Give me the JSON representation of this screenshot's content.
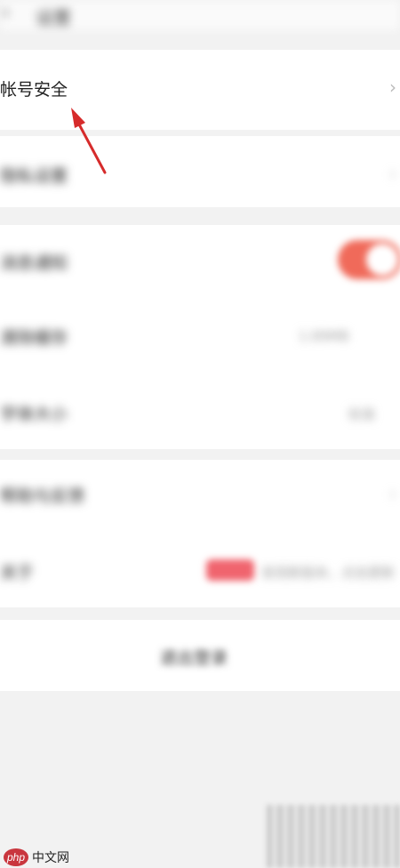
{
  "header": {
    "back_icon": "‹",
    "title": "设置"
  },
  "rows": {
    "account_security": {
      "label": "帐号安全",
      "chevron": "›"
    },
    "privacy": {
      "label": "隐私设置",
      "chevron": "›"
    },
    "notify": {
      "label": "消息通知"
    },
    "cache": {
      "label": "清除缓存",
      "value": "1.89MB"
    },
    "font": {
      "label": "字体大小",
      "value": "标准"
    },
    "help": {
      "label": "帮助与反馈",
      "chevron": "›"
    },
    "about": {
      "label": "关于",
      "value": "发现新版本，点击更新"
    }
  },
  "logout": {
    "label": "退出登录"
  },
  "watermark": {
    "logo_text": "php",
    "site_text": "中文网"
  },
  "colors": {
    "accent": "#f06a5a",
    "arrow": "#d62b2b"
  }
}
